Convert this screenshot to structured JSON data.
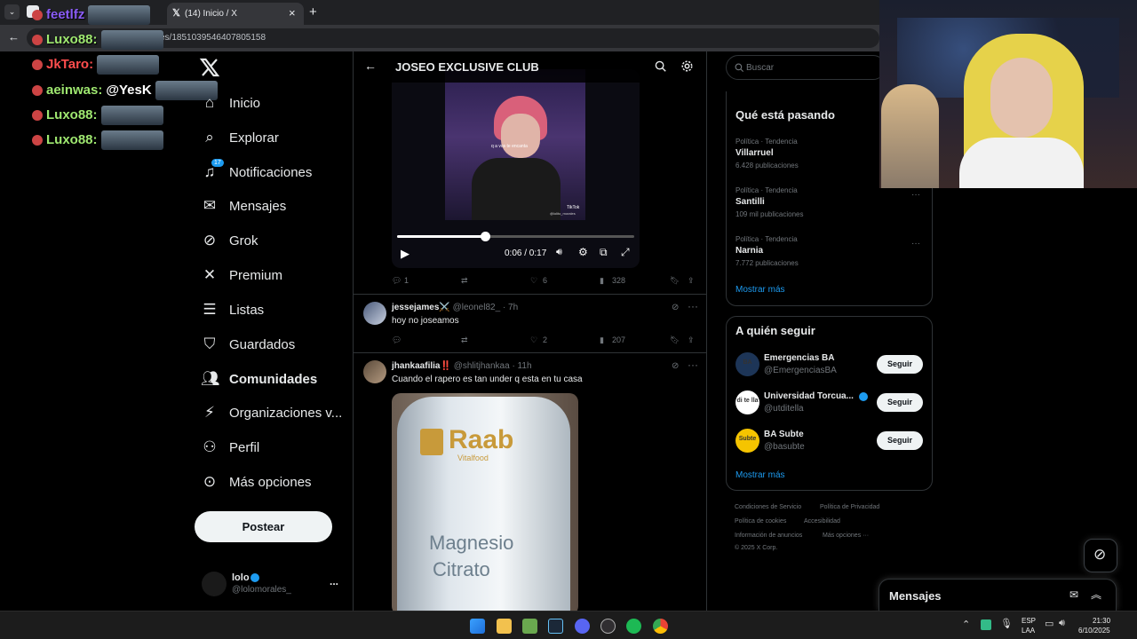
{
  "browser": {
    "tab_title": "(14) Inicio / X",
    "url": "es/1851039546407805158",
    "new_tab": "+",
    "close": "×"
  },
  "chat": {
    "lines": [
      {
        "user": "feetlfz",
        "text": "",
        "color": "#8a5cf6"
      },
      {
        "user": "Luxo88:",
        "text": "",
        "color": "#9fe870"
      },
      {
        "user": "JkTaro:",
        "text": "",
        "color": "#ff4d4d"
      },
      {
        "user": "aeinwas:",
        "text": "@YesK",
        "color": "#9fe870"
      },
      {
        "user": "Luxo88:",
        "text": "",
        "color": "#9fe870"
      },
      {
        "user": "Luxo88:",
        "text": "",
        "color": "#9fe870"
      }
    ]
  },
  "nav": {
    "items": [
      {
        "label": "Inicio",
        "icon": "home-icon"
      },
      {
        "label": "Explorar",
        "icon": "search-icon"
      },
      {
        "label": "Notificaciones",
        "icon": "bell-icon",
        "badge": "17"
      },
      {
        "label": "Mensajes",
        "icon": "mail-icon"
      },
      {
        "label": "Grok",
        "icon": "grok-icon"
      },
      {
        "label": "Premium",
        "icon": "x-logo-icon"
      },
      {
        "label": "Listas",
        "icon": "list-icon"
      },
      {
        "label": "Guardados",
        "icon": "bookmark-icon"
      },
      {
        "label": "Comunidades",
        "icon": "people-icon",
        "active": true
      },
      {
        "label": "Organizaciones v...",
        "icon": "bolt-icon"
      },
      {
        "label": "Perfil",
        "icon": "person-icon"
      },
      {
        "label": "Más opciones",
        "icon": "more-circle-icon"
      }
    ],
    "post_label": "Postear",
    "account": {
      "name": "lolo",
      "handle": "@lolomorales_",
      "more": "..."
    }
  },
  "community": {
    "title": "JOSEO EXCLUSIVE CLUB"
  },
  "video": {
    "caption": "q a vos te encanta",
    "watermark": "TikTok",
    "watermark_handle": "@lolito_morales",
    "time": "0:06 / 0:17",
    "progress": 0.37
  },
  "tweets": [
    {
      "replies": "1",
      "retweets": "",
      "likes": "6",
      "views": "328"
    },
    {
      "name": "jessejames",
      "emoji": "⚔️",
      "handle": "@leonel82_",
      "time": "· 7h",
      "text": "hoy no joseamos",
      "replies": "",
      "retweets": "",
      "likes": "2",
      "views": "207"
    },
    {
      "name": "jhankaafilia",
      "emoji": "‼️",
      "handle": "@shlitjhankaa",
      "time": "· 11h",
      "text": "Cuando el rapero es tan under q esta en tu casa"
    }
  ],
  "product": {
    "brand": "Raab",
    "sub": "Vitalfood",
    "line1": "Magnesio",
    "line2": "Citrato"
  },
  "search": {
    "placeholder": "Buscar"
  },
  "trends": {
    "title": "Qué está pasando",
    "items": [
      {
        "category": "Política · Tendencia",
        "name": "Villarruel",
        "count": "6.428 publicaciones"
      },
      {
        "category": "Política · Tendencia",
        "name": "Santilli",
        "count": "109 mil publicaciones"
      },
      {
        "category": "Política · Tendencia",
        "name": "Narnia",
        "count": "7.772 publicaciones"
      }
    ],
    "show_more": "Mostrar más"
  },
  "who_to_follow": {
    "title": "A quién seguir",
    "items": [
      {
        "name": "Emergencias BA",
        "handle": "@EmergenciasBA",
        "verified": false,
        "avatar_text": "BA",
        "avatar_color": "#1d3557"
      },
      {
        "name": "Universidad Torcua...",
        "handle": "@utditella",
        "verified": true,
        "avatar_text": "di te lla",
        "avatar_color": "#ffffff"
      },
      {
        "name": "BA Subte",
        "handle": "@basubte",
        "verified": false,
        "avatar_text": "Subte",
        "avatar_color": "#f5c400"
      }
    ],
    "follow_label": "Seguir",
    "show_more": "Mostrar más"
  },
  "footer": {
    "links": [
      "Condiciones de Servicio",
      "Política de Privacidad",
      "Política de cookies",
      "Accesibilidad",
      "Información de anuncios",
      "Más opciones ···"
    ],
    "copyright": "© 2025 X Corp."
  },
  "messages_drawer": {
    "title": "Mensajes"
  },
  "taskbar": {
    "lang1": "ESP",
    "lang2": "LAA",
    "time": "21:30",
    "date": "6/10/2025"
  },
  "colors": {
    "accent": "#1d9bf0",
    "border": "#2f3336",
    "muted": "#71767b"
  }
}
